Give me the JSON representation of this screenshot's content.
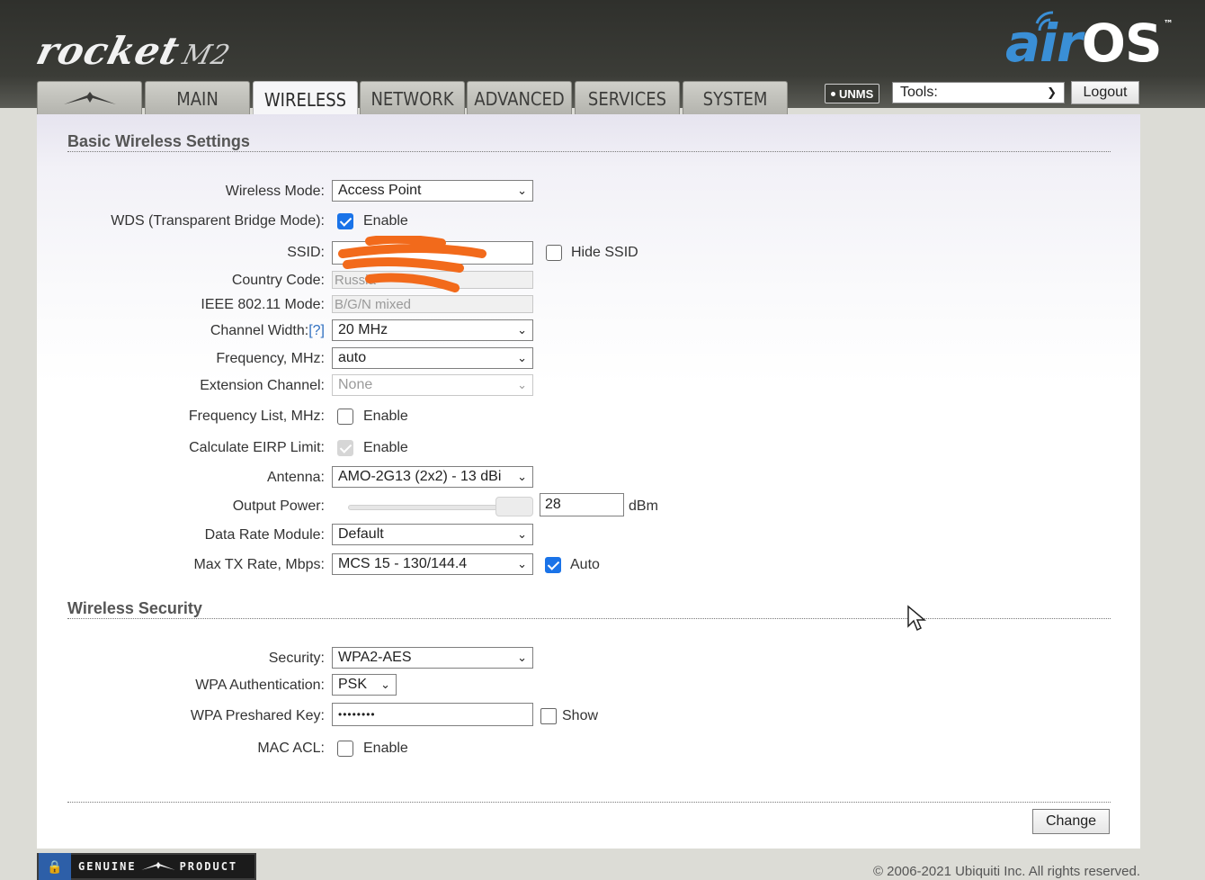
{
  "header": {
    "product_name": "rocket",
    "product_model": "M2",
    "brand_air": "air",
    "brand_os": "OS",
    "brand_tm": "™"
  },
  "tabs": [
    {
      "label": "",
      "icon": "ubiquiti-logo-icon"
    },
    {
      "label": "MAIN"
    },
    {
      "label": "WIRELESS",
      "active": true
    },
    {
      "label": "NETWORK"
    },
    {
      "label": "ADVANCED"
    },
    {
      "label": "SERVICES"
    },
    {
      "label": "SYSTEM"
    }
  ],
  "toolbar": {
    "unms_label": "UNMS",
    "tools_label": "Tools:",
    "logout_label": "Logout"
  },
  "basic": {
    "title": "Basic Wireless Settings",
    "wireless_mode": {
      "label": "Wireless Mode:",
      "value": "Access Point"
    },
    "wds": {
      "label": "WDS (Transparent Bridge Mode):",
      "checkbox_label": "Enable",
      "checked": true
    },
    "ssid": {
      "label": "SSID:",
      "value": "",
      "hide_label": "Hide SSID"
    },
    "country_code": {
      "label": "Country Code:",
      "value": "Russia"
    },
    "ieee_mode": {
      "label": "IEEE 802.11 Mode:",
      "value": "B/G/N mixed"
    },
    "channel_width": {
      "label": "Channel Width:",
      "help": "[?]",
      "value": "20 MHz"
    },
    "frequency": {
      "label": "Frequency, MHz:",
      "value": "auto"
    },
    "extension_channel": {
      "label": "Extension Channel:",
      "value": "None"
    },
    "frequency_list": {
      "label": "Frequency List, MHz:",
      "checkbox_label": "Enable",
      "checked": false
    },
    "eirp_limit": {
      "label": "Calculate EIRP Limit:",
      "checkbox_label": "Enable",
      "checked": true
    },
    "antenna": {
      "label": "Antenna:",
      "value": "AMO-2G13 (2x2) - 13 dBi"
    },
    "output_power": {
      "label": "Output Power:",
      "value": "28",
      "unit": "dBm",
      "slider_fraction": 1.0
    },
    "data_rate_module": {
      "label": "Data Rate Module:",
      "value": "Default"
    },
    "max_tx_rate": {
      "label": "Max TX Rate, Mbps:",
      "value": "MCS 15 - 130/144.4",
      "auto_label": "Auto",
      "auto_checked": true
    }
  },
  "security": {
    "title": "Wireless Security",
    "security": {
      "label": "Security:",
      "value": "WPA2-AES"
    },
    "wpa_auth": {
      "label": "WPA Authentication:",
      "value": "PSK"
    },
    "wpa_key": {
      "label": "WPA Preshared Key:",
      "value": "••••••••",
      "show_label": "Show"
    },
    "mac_acl": {
      "label": "MAC ACL:",
      "checkbox_label": "Enable",
      "checked": false
    }
  },
  "actions": {
    "change_label": "Change"
  },
  "footer": {
    "badge_text_left": "GENUINE",
    "badge_text_right": "PRODUCT",
    "copyright": "© 2006-2021 Ubiquiti Inc. All rights reserved."
  },
  "colors": {
    "accent": "#1a73e8",
    "brand_blue": "#3a8fd6",
    "redaction": "#f26a1b"
  }
}
